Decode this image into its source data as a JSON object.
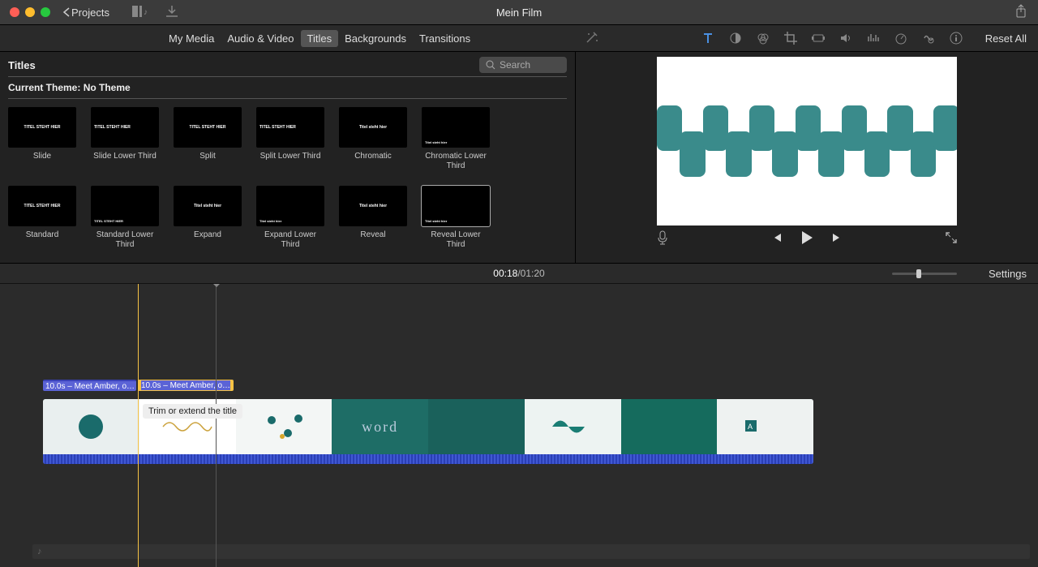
{
  "app": {
    "title": "Mein Film",
    "back": "Projects"
  },
  "media_tabs": [
    "My Media",
    "Audio & Video",
    "Titles",
    "Backgrounds",
    "Transitions"
  ],
  "media_tab_selected": 2,
  "reset_all": "Reset All",
  "browser": {
    "heading": "Titles",
    "search_placeholder": "Search",
    "theme_prefix": "Current Theme: ",
    "theme_name": "No Theme"
  },
  "titles": [
    {
      "label": "Slide",
      "thumb": "TITEL STEHT HIER",
      "style": "center"
    },
    {
      "label": "Slide Lower Third",
      "thumb": "TITEL STEHT HIER",
      "style": "left"
    },
    {
      "label": "Split",
      "thumb": "TITEL STEHT HIER",
      "style": "center"
    },
    {
      "label": "Split Lower Third",
      "thumb": "TITEL STEHT HIER",
      "style": "left"
    },
    {
      "label": "Chromatic",
      "thumb": "Titel steht hier",
      "style": "center"
    },
    {
      "label": "Chromatic Lower Third",
      "thumb": "Titel steht hier",
      "style": "bottom"
    },
    {
      "label": "Standard",
      "thumb": "TITEL STEHT HIER",
      "style": "center"
    },
    {
      "label": "Standard Lower Third",
      "thumb": "TITEL STEHT HIER",
      "style": "bottom"
    },
    {
      "label": "Expand",
      "thumb": "Titel steht hier",
      "style": "center"
    },
    {
      "label": "Expand Lower Third",
      "thumb": "Titel steht hier",
      "style": "bottom"
    },
    {
      "label": "Reveal",
      "thumb": "Titel steht hier",
      "style": "center"
    },
    {
      "label": "Reveal Lower Third",
      "thumb": "Titel steht hier",
      "style": "bottom",
      "selected": true
    }
  ],
  "time": {
    "current": "00:18",
    "sep": " / ",
    "total": "01:20"
  },
  "settings_label": "Settings",
  "timeline": {
    "title_bars": [
      {
        "text": "10.0s – Meet Amber, o…"
      },
      {
        "text": "10.0s – Meet Amber, o…"
      }
    ],
    "tooltip": "Trim or extend the title",
    "word_frame": "word"
  }
}
